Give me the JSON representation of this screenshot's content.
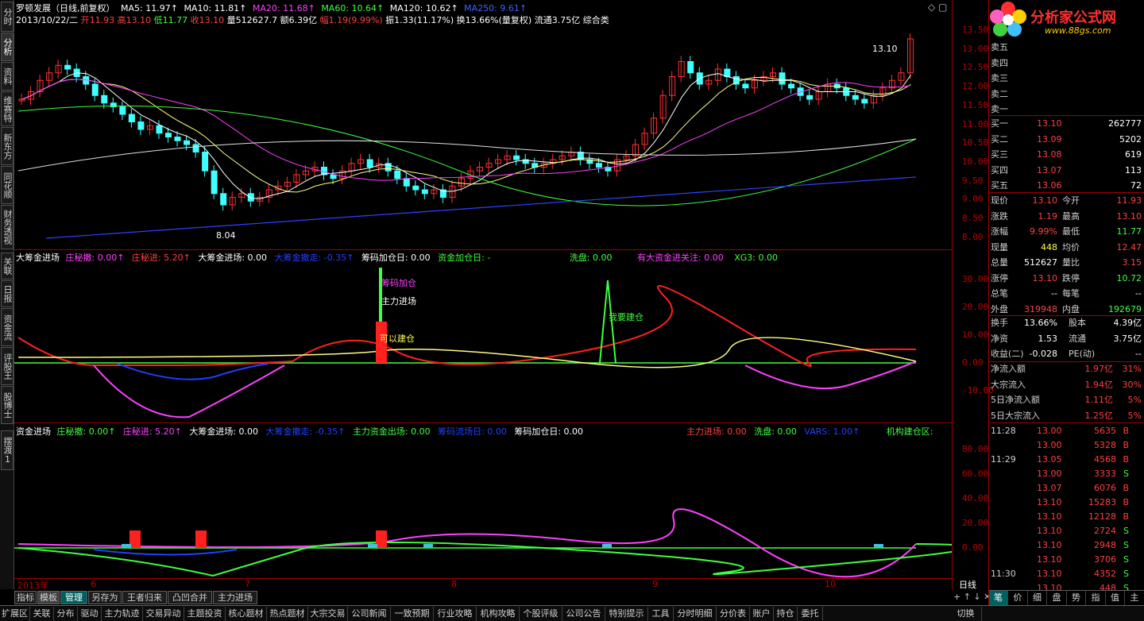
{
  "left_tabs": [
    "分时",
    "分析",
    "资料",
    "维赛特",
    "新东方",
    "同花顺",
    "财务透视",
    "关联",
    "日报",
    "资金流",
    "评股王",
    "股博士",
    "摆渡1"
  ],
  "header1": {
    "name": "罗顿发展（日线,前复权）",
    "ma5": "MA5: 11.97↑",
    "ma10": "MA10: 11.81↑",
    "ma20": "MA20: 11.68↑",
    "ma60": "MA60: 10.64↑",
    "ma120": "MA120: 10.62↑",
    "ma250": "MA250: 9.61↑"
  },
  "header2": {
    "date": "2013/10/22/二",
    "open": "开11.93",
    "high": "高13.10",
    "low": "低11.77",
    "close": "收13.10",
    "vol": "量512627.7",
    "amt": "额6.39亿",
    "chg": "幅1.19(9.99%)",
    "amp": "振1.33(11.17%)",
    "turn": "换13.66%(量复权)",
    "float": "流通3.75亿",
    "cat": "综合类"
  },
  "logo": {
    "text": "分析家公式网",
    "url": "www.88gs.com"
  },
  "main_y": [
    "13.50",
    "13.00",
    "12.50",
    "12.00",
    "11.50",
    "11.00",
    "10.50",
    "10.00",
    "9.50",
    "9.00",
    "8.50",
    "8.00"
  ],
  "price_labels": {
    "high": "13.10",
    "low": "8.04"
  },
  "ind1_header": {
    "a": "大筹金进场",
    "b": "庄秘撤: 0.00↑",
    "c": "庄秘进: 5.20↑",
    "d": "大筹金进场: 0.00",
    "e": "大筹金撤走: -0.35↑",
    "f": "筹码加仓日: 0.00",
    "g": "资金加仓日: -",
    "h": "洗盘: 0.00",
    "i": "有大资金进关注: 0.00",
    "j": "XG3: 0.00"
  },
  "ind1_y": [
    "30.00",
    "20.00",
    "10.00",
    "0.00",
    "-10.00"
  ],
  "ind1_notes": {
    "n1": "筹码加仓",
    "n2": "主力进场",
    "n3": "可以建仓",
    "n4": "我要建仓"
  },
  "ind2_header": {
    "a": "资金进场",
    "b": "庄秘撤: 0.00↑",
    "c": "庄秘进: 5.20↑",
    "d": "大筹金进场: 0.00",
    "e": "大筹金撤走: -0.35↑",
    "f": "主力资金出场: 0.00",
    "g": "筹码流场日: 0.00",
    "h": "筹码加仓日: 0.00",
    "i": "主力进场: 0.00",
    "j": "洗盘: 0.00",
    "k": "VARS: 1.00↑",
    "l": "机构建仓区:"
  },
  "ind2_y": [
    "80.00",
    "60.00",
    "40.00",
    "20.00",
    "0.00"
  ],
  "x_labels": [
    "2013年",
    "6",
    "7",
    "8",
    "9",
    "10"
  ],
  "x_right": "日线",
  "bottom_tabs": [
    "指标",
    "模板",
    "管理",
    "另存为",
    "王者归来",
    "凸凹合并",
    "主力进场"
  ],
  "bottom_bar": [
    "扩展区",
    "关联",
    "分布",
    "驱动",
    "主力轨迹",
    "交易异动",
    "主题投资",
    "核心题材",
    "热点题材",
    "大宗交易",
    "公司新闻",
    "一致预期",
    "行业攻略",
    "机构攻略",
    "个股评级",
    "公司公告",
    "特别提示",
    "工具",
    "分时明细",
    "分价表",
    "账户",
    "持仓",
    "委托",
    "切换"
  ],
  "right_tabs": [
    "笔",
    "价",
    "细",
    "盘",
    "势",
    "指",
    "值",
    "主"
  ],
  "sell_levels": [
    "卖五",
    "卖四",
    "卖三",
    "卖二",
    "卖一"
  ],
  "buy_levels": [
    [
      "买一",
      "13.10",
      "262777"
    ],
    [
      "买二",
      "13.09",
      "5202"
    ],
    [
      "买三",
      "13.08",
      "619"
    ],
    [
      "买四",
      "13.07",
      "113"
    ],
    [
      "买五",
      "13.06",
      "72"
    ]
  ],
  "quote_rows": [
    [
      "现价",
      "13.10",
      "今开",
      "11.93"
    ],
    [
      "涨跌",
      "1.19",
      "最高",
      "13.10"
    ],
    [
      "涨幅",
      "9.99%",
      "最低",
      "11.77"
    ],
    [
      "现量",
      "448",
      "均价",
      "12.47"
    ],
    [
      "总量",
      "512627",
      "量比",
      "3.15"
    ],
    [
      "涨停",
      "13.10",
      "跌停",
      "10.72"
    ],
    [
      "总笔",
      "--",
      "每笔",
      "--"
    ],
    [
      "外盘",
      "319948",
      "内盘",
      "192679"
    ]
  ],
  "quote_rows2": [
    [
      "换手",
      "13.66%",
      "股本",
      "4.39亿"
    ],
    [
      "净资",
      "1.53",
      "流通",
      "3.75亿"
    ],
    [
      "收益(二)",
      "-0.028",
      "PE(动)",
      "--"
    ]
  ],
  "flow_rows": [
    [
      "净流入额",
      "1.97亿",
      "31%"
    ],
    [
      "大宗流入",
      "1.94亿",
      "30%"
    ],
    [
      "5日净流入额",
      "1.11亿",
      "5%"
    ],
    [
      "5日大宗流入",
      "1.25亿",
      "5%"
    ]
  ],
  "ticks": [
    [
      "11:28",
      "13.00",
      "5635",
      "B"
    ],
    [
      "",
      "13.00",
      "5328",
      "B"
    ],
    [
      "11:29",
      "13.05",
      "4568",
      "B"
    ],
    [
      "",
      "13.00",
      "3333",
      "S"
    ],
    [
      "",
      "13.07",
      "6076",
      "B"
    ],
    [
      "",
      "13.10",
      "15283",
      "B"
    ],
    [
      "",
      "13.10",
      "12128",
      "B"
    ],
    [
      "",
      "13.10",
      "2724",
      "S"
    ],
    [
      "",
      "13.10",
      "2948",
      "S"
    ],
    [
      "",
      "13.10",
      "3706",
      "S"
    ],
    [
      "11:30",
      "13.10",
      "4352",
      "S"
    ],
    [
      "",
      "13.10",
      "448",
      "S"
    ]
  ]
}
